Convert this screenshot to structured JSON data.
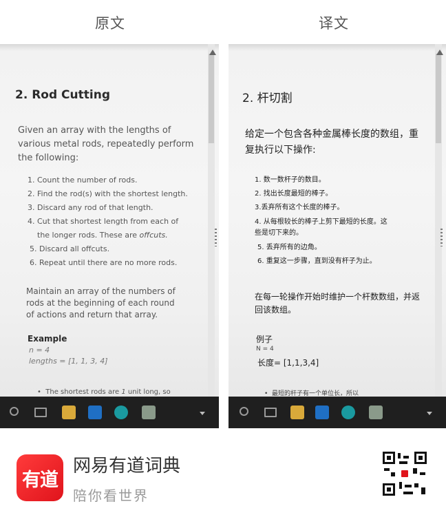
{
  "headers": {
    "original": "原文",
    "translation": "译文"
  },
  "original": {
    "title": "2. Rod Cutting",
    "intro": "Given an array with the lengths of various metal rods, repeatedly perform the following:",
    "steps": [
      "1. Count the number of rods.",
      "2. Find the rod(s) with the shortest length.",
      "3. Discard any rod of that length.",
      "4. Cut that shortest length from each of",
      "the longer rods. These are",
      "offcuts.",
      "5. Discard all offcuts.",
      "6. Repeat until there are no more rods."
    ],
    "para": "Maintain an array of the numbers of rods at the beginning of each round of actions and return that array.",
    "example_label": "Example",
    "example_n": "n = 4",
    "example_lengths": "lengths = [1, 1, 3, 4]",
    "bullet": "The shortest rods are",
    "bullet_italic": "1",
    "bullet_tail": "unit long, so"
  },
  "translation": {
    "title": "2. 杆切割",
    "intro": "给定一个包含各种金属棒长度的数组，重复执行以下操作:",
    "steps": [
      "1. 数一数杆子的数目。",
      "2. 找出长度最短的棒子。",
      "3.丢弃所有这个长度的棒子。",
      "4. 从每根较长的棒子上剪下最短的长度。这",
      "些是切下来的。",
      "5. 丢弃所有的边角。",
      "6. 重复这一步骤，直到没有杆子为止。"
    ],
    "para": "在每一轮操作开始时维护一个杆数数组，并返回该数组。",
    "example_label": "例子",
    "example_n": "N = 4",
    "example_lengths": "长度= [1,1,3,4]",
    "bullet": "最短的杆子有一个单位长，所以"
  },
  "brand": {
    "logo_text": "有道",
    "name": "网易有道词典",
    "slogan": "陪你看世界"
  },
  "taskbar_icons": [
    "search-icon",
    "task-view-icon",
    "folder-icon",
    "outlook-icon",
    "edge-icon",
    "app-icon"
  ],
  "colors": {
    "brand_red": "#e0141c",
    "taskbar": "#1f1f1f"
  }
}
